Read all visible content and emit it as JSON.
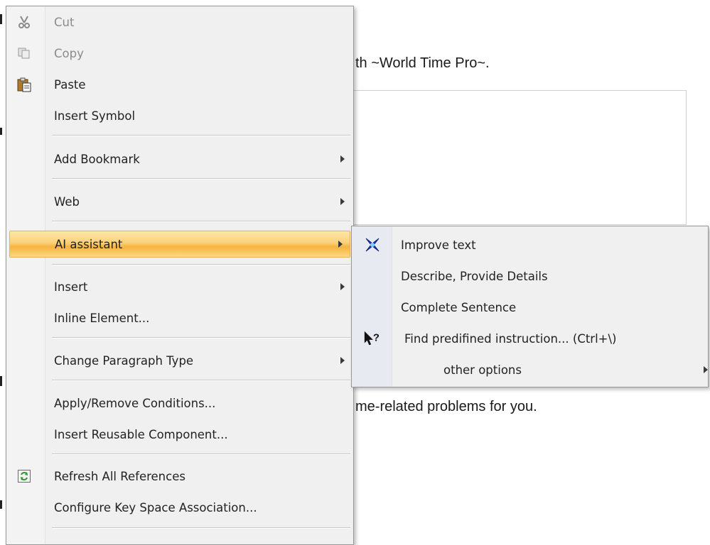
{
  "document": {
    "line1": "th ~World Time Pro~.",
    "line2": "me-related problems for you."
  },
  "context_menu": {
    "items": [
      {
        "label": "Cut",
        "icon": "scissors-icon",
        "disabled": true
      },
      {
        "label": "Copy",
        "icon": "copy-icon",
        "disabled": true
      },
      {
        "label": "Paste",
        "icon": "paste-icon",
        "disabled": false
      },
      {
        "label": "Insert Symbol"
      },
      {
        "label": "Add Bookmark",
        "submenu": true
      },
      {
        "label": "Web",
        "submenu": true
      },
      {
        "label": "AI assistant",
        "submenu": true,
        "highlighted": true
      },
      {
        "label": "Insert",
        "submenu": true
      },
      {
        "label": "Inline Element..."
      },
      {
        "label": "Change Paragraph Type",
        "submenu": true
      },
      {
        "label": "Apply/Remove Conditions..."
      },
      {
        "label": "Insert Reusable Component..."
      },
      {
        "label": "Refresh All References",
        "icon": "refresh-icon"
      },
      {
        "label": "Configure Key Space Association..."
      }
    ]
  },
  "ai_submenu": {
    "items": [
      {
        "label": "Improve text",
        "icon": "sparkle-x-icon"
      },
      {
        "label": "Describe, Provide Details"
      },
      {
        "label": "Complete Sentence"
      },
      {
        "label": "Find predifined instruction... (Ctrl+\\)",
        "icon": "help-pointer-icon"
      },
      {
        "label": "other options",
        "submenu": true
      }
    ]
  },
  "colors": {
    "highlight_top": "#fde7a6",
    "highlight_mid": "#f6b53d",
    "menu_bg": "#f0f0f0",
    "sparkle_blue": "#1a3fc8"
  }
}
